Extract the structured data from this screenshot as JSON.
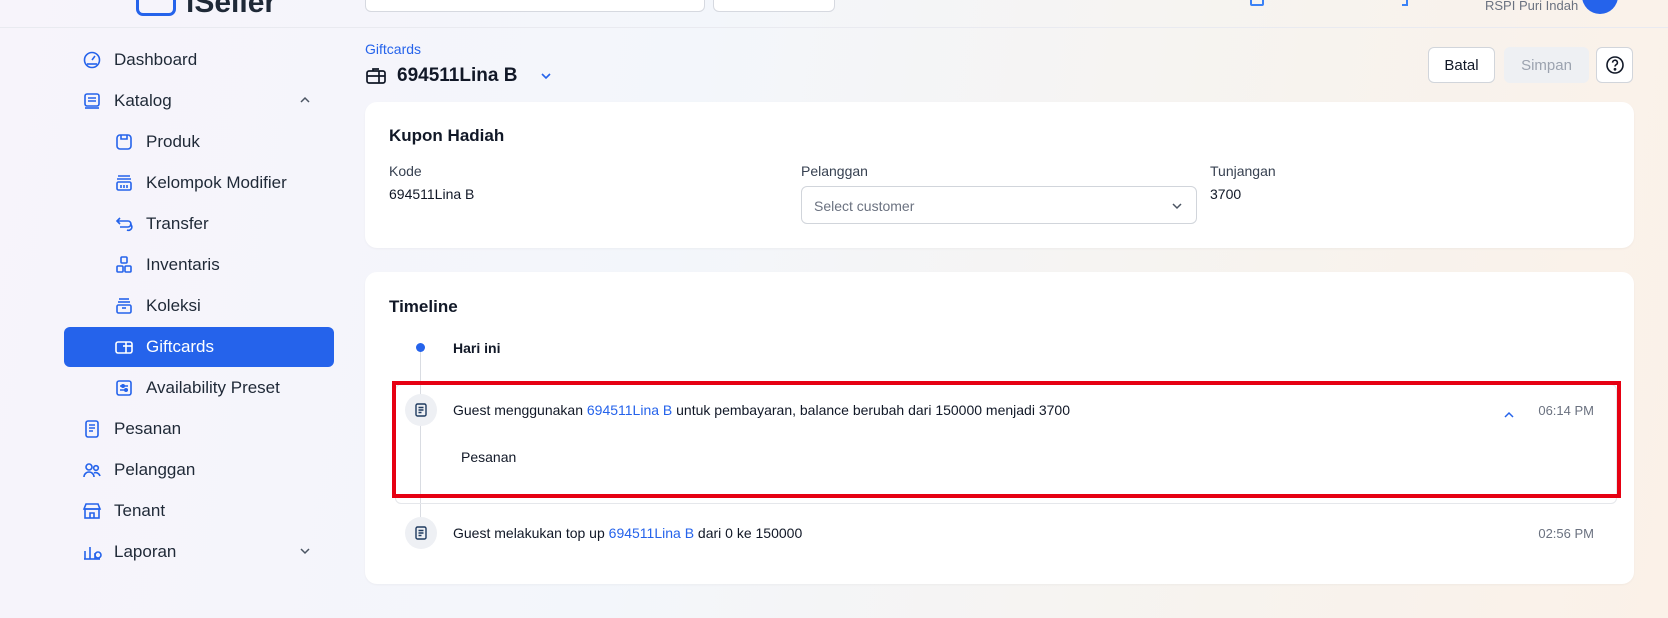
{
  "topbar": {
    "logo_text": "iSeller",
    "store_name": "RSPI Puri Indah"
  },
  "sidebar": {
    "items": [
      {
        "label": "Dashboard",
        "icon": "dashboard-icon"
      },
      {
        "label": "Katalog",
        "icon": "catalog-icon"
      },
      {
        "label": "Produk",
        "icon": "product-icon"
      },
      {
        "label": "Kelompok Modifier",
        "icon": "modifier-icon"
      },
      {
        "label": "Transfer",
        "icon": "transfer-icon"
      },
      {
        "label": "Inventaris",
        "icon": "inventory-icon"
      },
      {
        "label": "Koleksi",
        "icon": "collection-icon"
      },
      {
        "label": "Giftcards",
        "icon": "giftcard-icon"
      },
      {
        "label": "Availability Preset",
        "icon": "availability-icon"
      },
      {
        "label": "Pesanan",
        "icon": "order-icon"
      },
      {
        "label": "Pelanggan",
        "icon": "customer-icon"
      },
      {
        "label": "Tenant",
        "icon": "tenant-icon"
      },
      {
        "label": "Laporan",
        "icon": "report-icon"
      }
    ],
    "active": "Giftcards"
  },
  "header": {
    "breadcrumb": "Giftcards",
    "title": "694511Lina B",
    "cancel_label": "Batal",
    "save_label": "Simpan"
  },
  "giftcard": {
    "section_title": "Kupon Hadiah",
    "code_label": "Kode",
    "code_value": "694511Lina B",
    "customer_label": "Pelanggan",
    "customer_placeholder": "Select customer",
    "balance_label": "Tunjangan",
    "balance_value": "3700"
  },
  "timeline": {
    "section_title": "Timeline",
    "group_label": "Hari ini",
    "events": [
      {
        "prefix": "Guest menggunakan",
        "link": "694511Lina B",
        "suffix": "untuk pembayaran, balance berubah dari 150000 menjadi 3700",
        "time": "06:14 PM",
        "detail": "Pesanan"
      },
      {
        "prefix": "Guest melakukan top up",
        "link": "694511Lina B",
        "suffix": "dari 0 ke 150000",
        "time": "02:56 PM"
      }
    ]
  },
  "colors": {
    "accent": "#2563eb",
    "highlight": "#e60012"
  }
}
